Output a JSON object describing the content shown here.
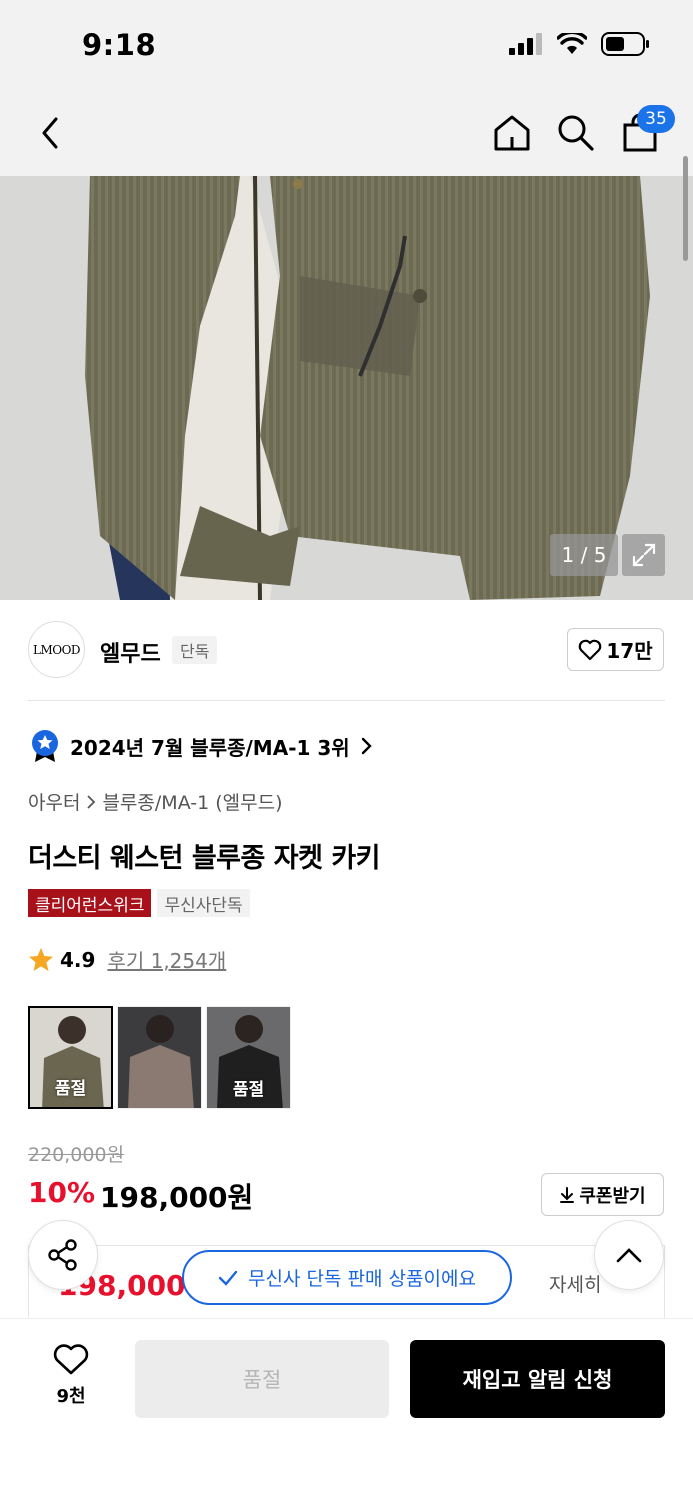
{
  "status_bar": {
    "time": "9:18"
  },
  "nav": {
    "cart_count": "35"
  },
  "gallery": {
    "counter": "1 / 5"
  },
  "brand": {
    "logo_text": "LMOOD",
    "name": "엘무드",
    "tag": "단독",
    "likes": "17만"
  },
  "ranking": {
    "text": "2024년 7월 블루종/MA-1 3위"
  },
  "breadcrumb": {
    "category": "아우터",
    "subcategory": "블루종/MA-1 (엘무드)"
  },
  "product": {
    "title": "더스티 웨스턴 블루종 자켓 카키",
    "tags": [
      "클리어런스위크",
      "무신사단독"
    ],
    "rating": "4.9",
    "reviews": "후기 1,254개"
  },
  "colors": [
    {
      "label": "품절",
      "swatch": "#6b6650"
    },
    {
      "label": "",
      "swatch": "#8a7a72"
    },
    {
      "label": "품절",
      "swatch": "#1f1f1f"
    }
  ],
  "pricing": {
    "original": "220,000원",
    "discount": "10%",
    "price": "198,000원",
    "coupon_label": "쿠폰받기",
    "benefit_price": "198,000원",
    "benefit_detail": "자세히"
  },
  "exclusive_banner": "무신사 단독 판매 상품이에요",
  "bottom": {
    "wish_count": "9천",
    "soldout_label": "품절",
    "restock_label": "재입고 알림 신청"
  },
  "theme": {
    "accent_red": "#e8112d",
    "accent_blue": "#1a66e0",
    "tag_red": "#a8101a"
  }
}
